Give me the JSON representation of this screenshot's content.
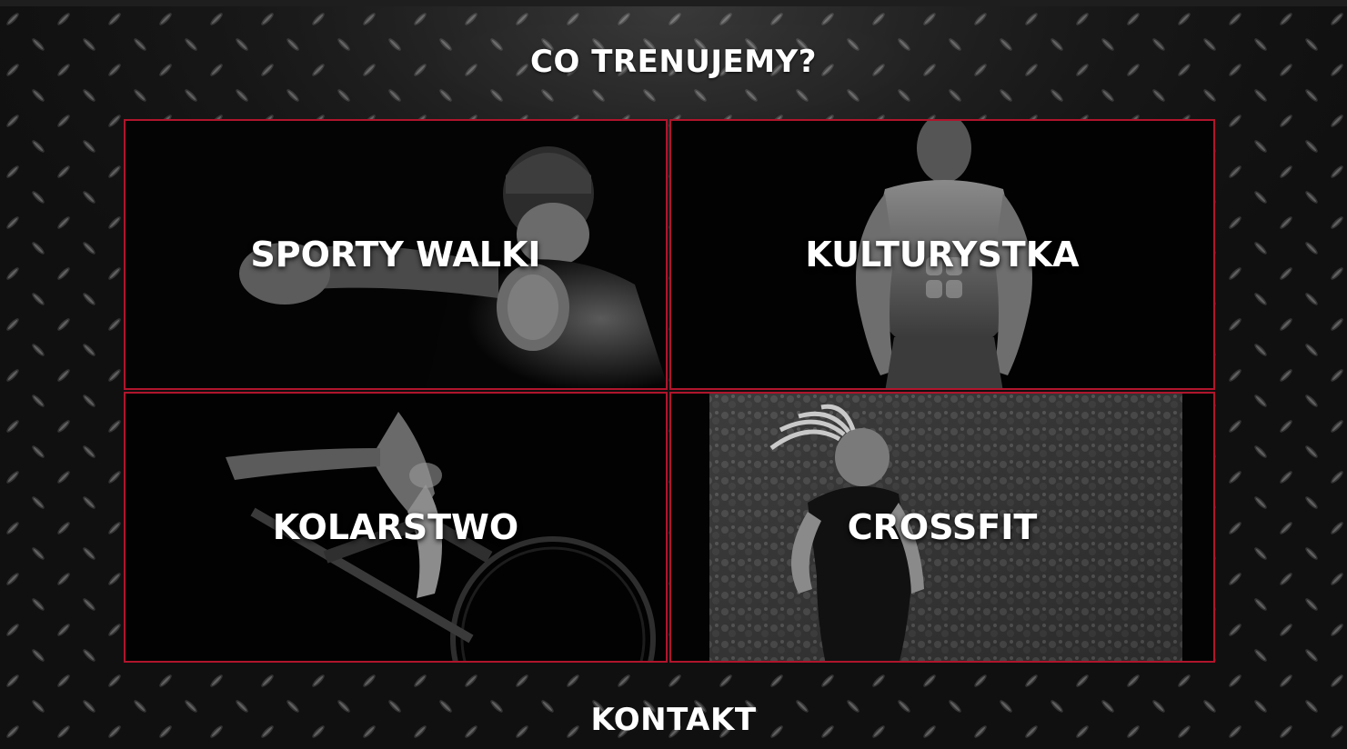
{
  "section": {
    "title": "CO TRENUJEMY?"
  },
  "tiles": [
    {
      "label": "SPORTY WALKI",
      "image": "boxer-photo"
    },
    {
      "label": "KULTURYSTKA",
      "image": "bodybuilder-photo"
    },
    {
      "label": "KOLARSTWO",
      "image": "cyclist-photo"
    },
    {
      "label": "CROSSFIT",
      "image": "runner-photo"
    }
  ],
  "footer": {
    "title": "KONTAKT"
  },
  "colors": {
    "accent": "#b0152c",
    "background": "#0d0d0d",
    "text": "#ffffff"
  }
}
